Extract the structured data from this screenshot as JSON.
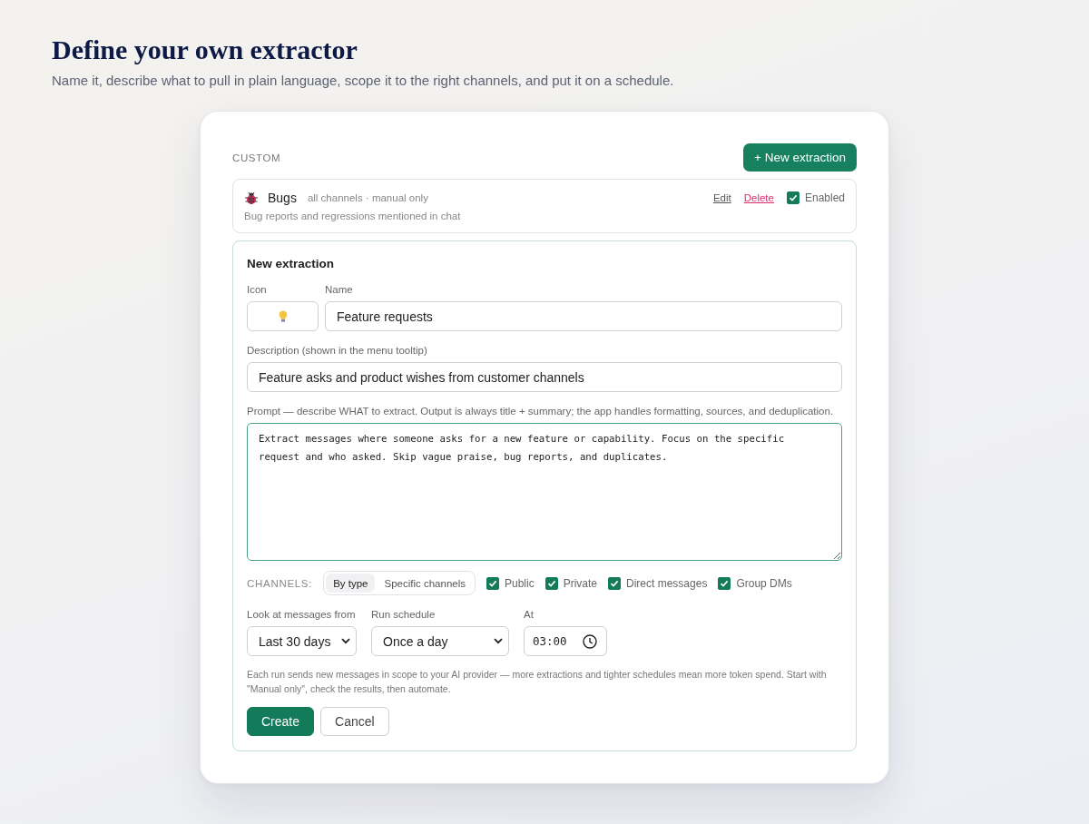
{
  "header": {
    "title": "Define your own extractor",
    "subtitle": "Name it, describe what to pull in plain language, scope it to the right channels, and put it on a schedule."
  },
  "custom": {
    "label": "CUSTOM",
    "new_button": "+ New extraction",
    "extractors": [
      {
        "name": "Bugs",
        "meta": "all channels · manual only",
        "description": "Bug reports and regressions mentioned in chat",
        "edit": "Edit",
        "delete": "Delete",
        "enabled": true,
        "enabled_label": "Enabled"
      }
    ]
  },
  "form": {
    "title": "New extraction",
    "icon_label": "Icon",
    "name_label": "Name",
    "name_value": "Feature requests",
    "description_label": "Description (shown in the menu tooltip)",
    "description_value": "Feature asks and product wishes from customer channels",
    "prompt_label": "Prompt — describe WHAT to extract. Output is always title + summary; the app handles formatting, sources, and deduplication.",
    "prompt_value": "Extract messages where someone asks for a new feature or capability. Focus on the specific request and who asked. Skip vague praise, bug reports, and duplicates.",
    "channels": {
      "label": "CHANNELS:",
      "modes": [
        {
          "label": "By type",
          "selected": true
        },
        {
          "label": "Specific channels",
          "selected": false
        }
      ],
      "types": [
        {
          "label": "Public",
          "checked": true
        },
        {
          "label": "Private",
          "checked": true
        },
        {
          "label": "Direct messages",
          "checked": true
        },
        {
          "label": "Group DMs",
          "checked": true
        }
      ]
    },
    "lookback": {
      "label": "Look at messages from",
      "value": "Last 30 days"
    },
    "schedule": {
      "label": "Run schedule",
      "value": "Once a day"
    },
    "time": {
      "label": "At",
      "value": "03:00"
    },
    "note": "Each run sends new messages in scope to your AI provider — more extractions and tighter schedules mean more token spend. Start with \"Manual only\", check the results, then automate.",
    "buttons": [
      {
        "label": "Create",
        "kind": "primary"
      },
      {
        "label": "Cancel",
        "kind": "secondary"
      }
    ]
  }
}
